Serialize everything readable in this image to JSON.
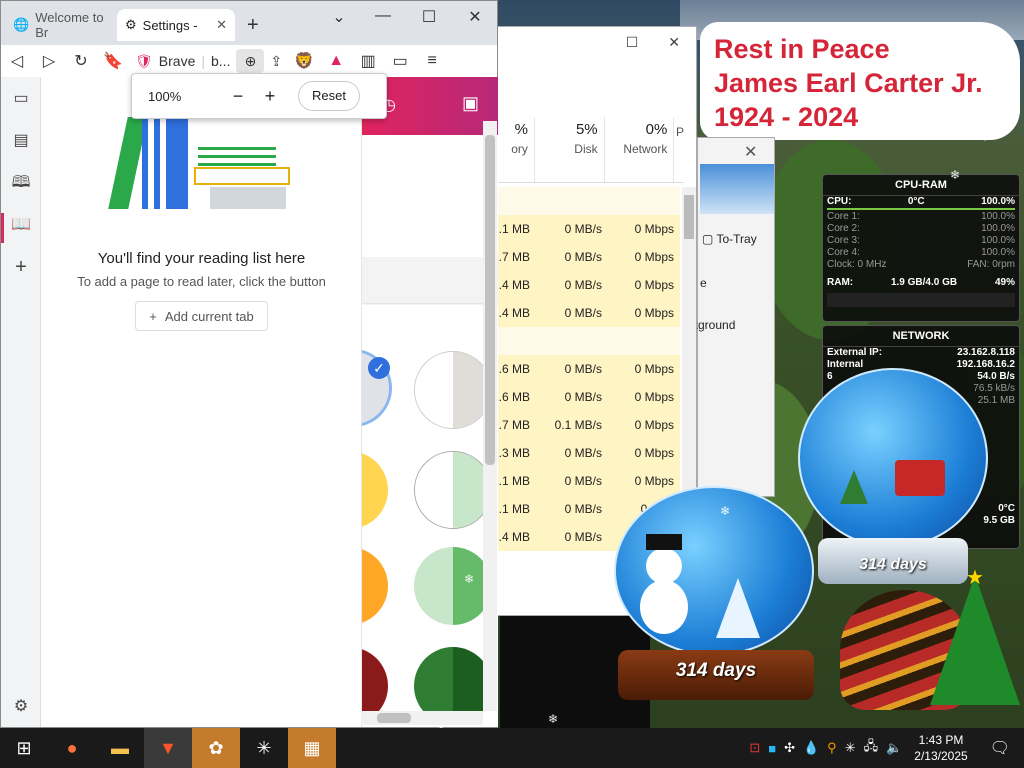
{
  "browser": {
    "tabs": [
      {
        "label": "Welcome to Br",
        "icon": "globe-icon"
      },
      {
        "label": "Settings -",
        "icon": "gear-icon"
      }
    ],
    "new_tab_label": "+",
    "address_brand": "Brave",
    "address_text": "b...",
    "zoom_popup": {
      "value": "100%",
      "minus": "−",
      "plus": "+",
      "reset": "Reset"
    },
    "reading_list": {
      "title": "You'll find your reading list here",
      "subtitle": "To add a page to read later, click the button",
      "add_button": "Add current tab",
      "add_icon": "+"
    }
  },
  "taskmgr": {
    "columns": [
      {
        "pct": "%",
        "label": "ory"
      },
      {
        "pct": "5%",
        "label": "Disk"
      },
      {
        "pct": "0%",
        "label": "Network"
      },
      {
        "pct": "",
        "label": "P"
      }
    ],
    "rows": [
      {
        "mem": "",
        "disk": "",
        "net": "",
        "style": "light"
      },
      {
        "mem": ".1 MB",
        "disk": "0 MB/s",
        "net": "0 Mbps",
        "style": "yellow"
      },
      {
        "mem": ".7 MB",
        "disk": "0 MB/s",
        "net": "0 Mbps",
        "style": "yellow"
      },
      {
        "mem": ".4 MB",
        "disk": "0 MB/s",
        "net": "0 Mbps",
        "style": "yellow"
      },
      {
        "mem": ".4 MB",
        "disk": "0 MB/s",
        "net": "0 Mbps",
        "style": "yellow"
      },
      {
        "mem": "",
        "disk": "",
        "net": "",
        "style": "light"
      },
      {
        "mem": ".6 MB",
        "disk": "0 MB/s",
        "net": "0 Mbps",
        "style": "yellow"
      },
      {
        "mem": ".6 MB",
        "disk": "0 MB/s",
        "net": "0 Mbps",
        "style": "yellow"
      },
      {
        "mem": ".7 MB",
        "disk": "0.1 MB/s",
        "net": "0 Mbps",
        "style": "yellow"
      },
      {
        "mem": ".3 MB",
        "disk": "0 MB/s",
        "net": "0 Mbps",
        "style": "yellow"
      },
      {
        "mem": ".1 MB",
        "disk": "0 MB/s",
        "net": "0 Mbps",
        "style": "yellow"
      },
      {
        "mem": ".1 MB",
        "disk": "0 MB/s",
        "net": "0 Mbp",
        "style": "yellow"
      },
      {
        "mem": ".4 MB",
        "disk": "0 MB/s",
        "net": "",
        "style": "yellow"
      }
    ],
    "dialog": {
      "to_tray": "To-Tray",
      "e": "e",
      "kground": "kground"
    }
  },
  "memorial": {
    "line1": "Rest in Peace",
    "line2": "James Earl Carter Jr.",
    "line3": "1924 - 2024"
  },
  "cpu_gadget": {
    "title": "CPU-RAM",
    "cpu_label": "CPU:",
    "cpu_temp": "0°C",
    "cpu_pct": "100.0%",
    "cores": [
      {
        "label": "Core 1:",
        "pct": "100.0%"
      },
      {
        "label": "Core 2:",
        "pct": "100.0%"
      },
      {
        "label": "Core 3:",
        "pct": "100.0%"
      },
      {
        "label": "Core 4:",
        "pct": "100.0%"
      }
    ],
    "clock": "Clock: 0 MHz",
    "fan": "FAN: 0rpm",
    "ram_label": "RAM:",
    "ram_value": "1.9 GB/4.0 GB",
    "ram_pct": "49%"
  },
  "net_gadget": {
    "title": "NETWORK",
    "ext_label": "External IP:",
    "ext_ip": "23.162.8.118",
    "int_label": "Internal",
    "int_ip": "192.168.16.2",
    "down_prefix": "6",
    "down": "54.0 B/s",
    "up": "76.5 kB/s",
    "total": "25.1 MB",
    "temp": "0°C",
    "storage": "9.5 GB"
  },
  "globes": {
    "left_days": "314 days",
    "right_days": "314 days"
  },
  "taskbar": {
    "time": "1:43 PM",
    "date": "2/13/2025"
  },
  "colors": {
    "brave_accent": "#e0245e",
    "sidebar_active": "#d42a5c",
    "tm_highlight": "#fff4c4",
    "memorial_text": "#d42638"
  }
}
